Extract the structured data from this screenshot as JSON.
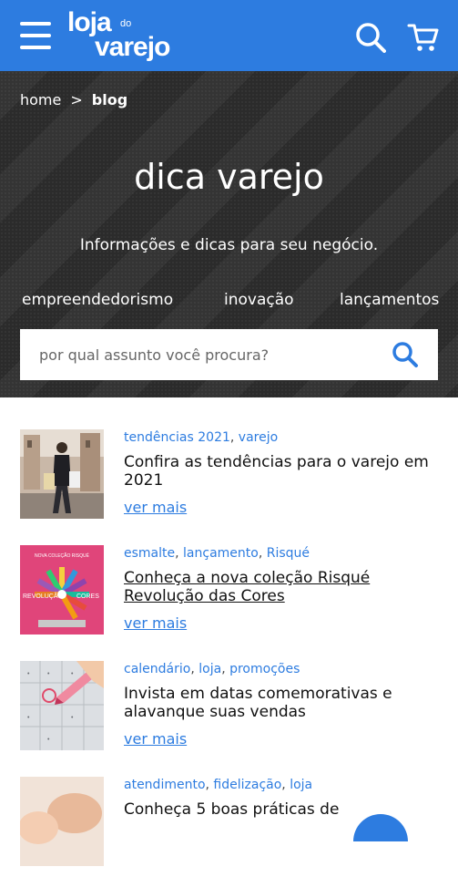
{
  "brand": {
    "logo_line1": "loja",
    "logo_small": "do",
    "logo_line2": "varejo",
    "color": "#2d7ce0"
  },
  "header": {
    "menu_icon": "menu-icon",
    "search_icon": "search-icon",
    "cart_icon": "cart-icon"
  },
  "breadcrumb": {
    "home": "home",
    "separator": ">",
    "current": "blog"
  },
  "hero": {
    "title": "dica varejo",
    "subtitle": "Informações e dicas para seu negócio.",
    "categories": [
      "empreendedorismo",
      "inovação",
      "lançamentos"
    ]
  },
  "search": {
    "placeholder": "por qual assunto você procura?"
  },
  "posts": [
    {
      "tags": [
        "tendências 2021",
        "varejo"
      ],
      "title": "Confira as tendências para o varejo em 2021",
      "more": "ver mais"
    },
    {
      "tags": [
        "esmalte",
        "lançamento",
        "Risqué"
      ],
      "title": "Conheça a nova coleção Risqué Revolução das Cores",
      "more": "ver mais",
      "thumb_text": {
        "top": "NOVA COLEÇÃO RISQUÉ",
        "left": "REVOLUÇÃO",
        "right": "CORES"
      }
    },
    {
      "tags": [
        "calendário",
        "loja",
        "promoções"
      ],
      "title": "Invista em datas comemorativas e alavanque suas vendas",
      "more": "ver mais"
    },
    {
      "tags": [
        "atendimento",
        "fidelização",
        "loja"
      ],
      "title": "Conheça 5 boas práticas de",
      "more": ""
    }
  ]
}
